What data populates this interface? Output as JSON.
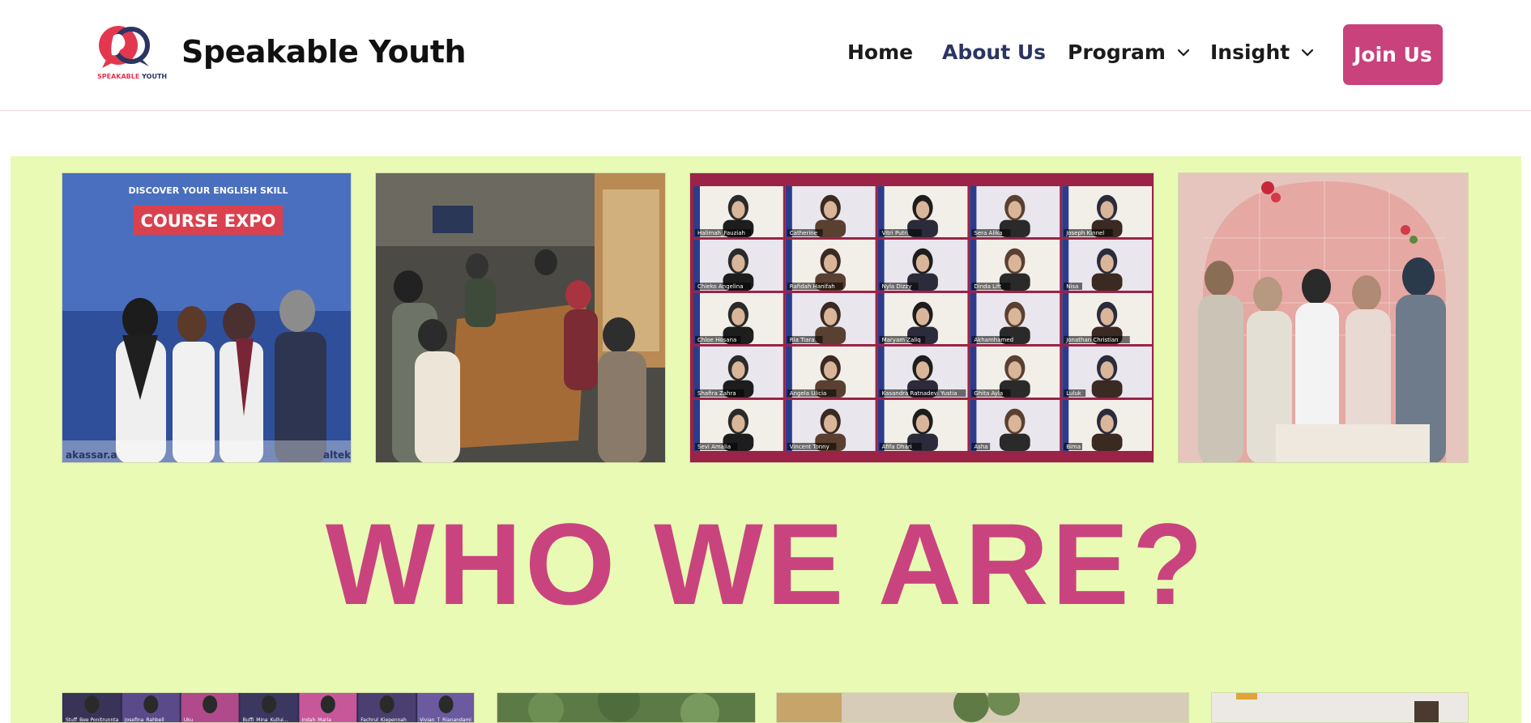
{
  "header": {
    "brand_name": "Speakable Youth",
    "logo_text_left": "SPEAKABLE",
    "logo_text_right": "YOUTH",
    "nav": [
      {
        "label": "Home",
        "dropdown": false,
        "active": false
      },
      {
        "label": "About Us",
        "dropdown": false,
        "active": true
      },
      {
        "label": "Program",
        "dropdown": true,
        "active": false
      },
      {
        "label": "Insight",
        "dropdown": true,
        "active": false
      }
    ],
    "cta_label": "Join Us"
  },
  "hero": {
    "heading": "WHO WE ARE?",
    "top_photos": [
      {
        "poster_line1": "DISCOVER YOUR ENGLISH SKILL",
        "poster_line2": "COURSE EXPO",
        "banner_edge_left": "akassar.a",
        "banner_edge_right": "altek"
      },
      {},
      {
        "video_call_names": [
          "Halimah_Fauziah",
          "Catherine",
          "Vitri Putri",
          "Sera Alika",
          "Joseph Kinnel",
          "Chieko Angelina",
          "Rafidah Hanifah",
          "Nyla Dizzy",
          "Dinda Lift",
          "Nisa",
          "Chloe Hosana",
          "Ria Tiara",
          "Maryam Zaliq",
          "Akhamhamed",
          "Jonathan Christian",
          "Shafira Zahra",
          "Angela Ulicia",
          "Kasandra Ratnadevi Yustia",
          "Ghita Ayla",
          "Luluk",
          "Sevi Amalia",
          "Vincent Tonny",
          "Afifa Dhari",
          "Asha",
          "Bima"
        ]
      },
      {}
    ],
    "bottom_strip_names": [
      "Stuff_Bee Ponitrunnta",
      "Josefina_Rahbell",
      "Uku",
      "Buffi_Mina_Kullui...",
      "Indah_Maria",
      "Fachrul_Kiepennah",
      "Vivian_T_Rianandami"
    ]
  },
  "colors": {
    "brand_pink": "#c9427c",
    "nav_active": "#2b3562",
    "hero_background": "#e8fab4"
  }
}
